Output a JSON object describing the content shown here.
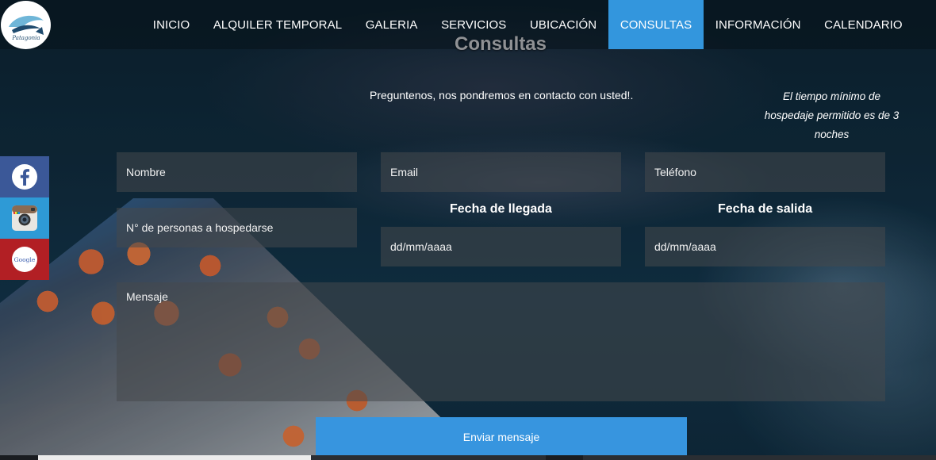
{
  "nav": {
    "items": [
      {
        "label": "INICIO",
        "active": false
      },
      {
        "label": "ALQUILER TEMPORAL",
        "active": false
      },
      {
        "label": "GALERIA",
        "active": false
      },
      {
        "label": "SERVICIOS",
        "active": false
      },
      {
        "label": "UBICACIÓN",
        "active": false
      },
      {
        "label": "CONSULTAS",
        "active": true
      },
      {
        "label": "INFORMACIÓN",
        "active": false
      },
      {
        "label": "CALENDARIO",
        "active": false
      }
    ],
    "active_color": "#3396dd"
  },
  "logo": {
    "text": "Patagonia"
  },
  "page": {
    "title": "Consultas"
  },
  "intro": "Preguntenos, nos pondremos en contacto con usted!.",
  "note": "El tiempo mínimo de hospedaje permitido es de 3 noches",
  "form": {
    "name_placeholder": "Nombre",
    "email_placeholder": "Email",
    "phone_placeholder": "Teléfono",
    "guests_placeholder": "N° de personas a hospedarse",
    "arrival_label": "Fecha de llegada",
    "departure_label": "Fecha de salida",
    "arrival_placeholder": "dd/mm/aaaa",
    "departure_placeholder": "dd/mm/aaaa",
    "message_placeholder": "Mensaje",
    "submit_label": "Enviar mensaje",
    "submit_color": "#3795df"
  },
  "social": [
    {
      "icon": "facebook-icon",
      "color": "#3b5898"
    },
    {
      "icon": "instagram-icon",
      "color": "#2e9ad6"
    },
    {
      "icon": "google-icon",
      "label": "Google",
      "color": "#b21f24"
    }
  ]
}
